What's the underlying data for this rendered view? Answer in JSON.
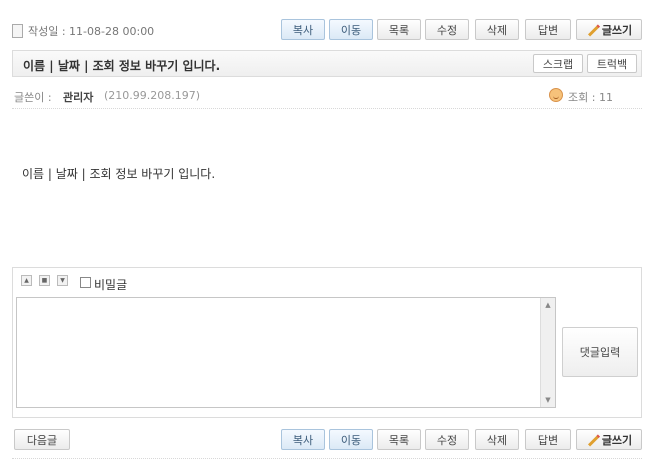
{
  "meta": {
    "date_label": "작성일 : 11-08-28 00:00"
  },
  "toolbar": {
    "copy": "복사",
    "move": "이동",
    "list": "목록",
    "edit": "수정",
    "delete": "삭제",
    "reply": "답변",
    "write": "글쓰기"
  },
  "post": {
    "title": "이름 | 날짜 | 조회 정보 바꾸기 입니다.",
    "scrap": "스크랩",
    "trackback": "트럭백",
    "author_label": "글쓴이 :",
    "author_name": "관리자",
    "author_ip": "(210.99.208.197)",
    "views_label": "조회 : 11",
    "body": "이름 | 날짜 | 조회 정보 바꾸기 입니다."
  },
  "comment": {
    "secret_label": "비밀글",
    "submit_label": "댓글입력",
    "text": ""
  },
  "footer": {
    "next_label": "다음글"
  },
  "colors": {
    "blue_btn_bg": "#dbe9f6",
    "border": "#dcdcdc"
  }
}
